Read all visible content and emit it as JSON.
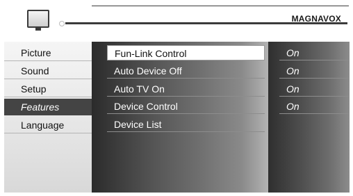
{
  "brand": "MAGNAVOX",
  "header": {
    "icon": "tv-icon"
  },
  "left_menu": {
    "items": [
      {
        "label": "Picture"
      },
      {
        "label": "Sound"
      },
      {
        "label": "Setup"
      },
      {
        "label": "Features",
        "active": true
      },
      {
        "label": "Language"
      }
    ]
  },
  "features_menu": {
    "items": [
      {
        "label": "Fun-Link Control",
        "selected": true
      },
      {
        "label": "Auto Device Off"
      },
      {
        "label": "Auto TV On"
      },
      {
        "label": "Device Control"
      },
      {
        "label": "Device List"
      }
    ]
  },
  "values": {
    "items": [
      {
        "value": "On"
      },
      {
        "value": "On"
      },
      {
        "value": "On"
      },
      {
        "value": "On"
      }
    ]
  },
  "colors": {
    "active_bg": "#444444",
    "selected_bg": "#ffffff",
    "text_light": "#ffffff",
    "text_dark": "#111111"
  }
}
